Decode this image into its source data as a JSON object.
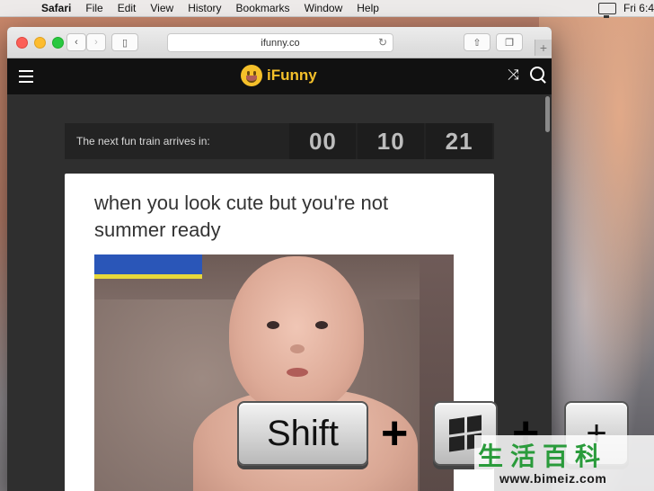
{
  "menubar": {
    "apple": "",
    "app": "Safari",
    "items": [
      "File",
      "Edit",
      "View",
      "History",
      "Bookmarks",
      "Window",
      "Help"
    ],
    "clock": "Fri 6:4"
  },
  "browser": {
    "address": "ifunny.co",
    "reload_icon": "↻",
    "back_icon": "‹",
    "forward_icon": "›",
    "sidebar_icon": "▯",
    "share_icon": "⇧",
    "tabs_icon": "❐",
    "new_tab_icon": "+"
  },
  "site": {
    "logo": "iFunny",
    "shuffle_icon": "⤨"
  },
  "timer": {
    "label": "The next fun train arrives in:",
    "hours": "00",
    "minutes": "10",
    "seconds": "21"
  },
  "post": {
    "caption": "when you look cute but you're not summer ready"
  },
  "keys": {
    "shift": "Shift",
    "plus1": "+",
    "plus2": "+",
    "last": "+"
  },
  "watermark": {
    "cn": "生活百科",
    "url": "www.bimeiz.com"
  }
}
